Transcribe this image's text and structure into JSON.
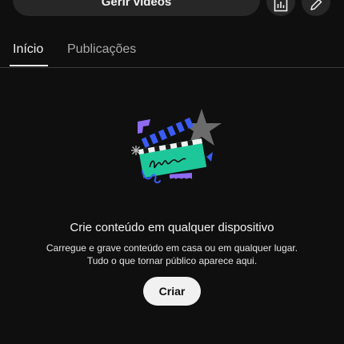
{
  "toolbar": {
    "manage_videos_label": "Gerir vídeos",
    "analytics_icon": "bar-chart-icon",
    "edit_icon": "pencil-icon"
  },
  "tabs": [
    {
      "label": "Início",
      "active": true
    },
    {
      "label": "Publicações",
      "active": false
    }
  ],
  "empty_state": {
    "illustration_icon": "clapperboard-illustration",
    "title": "Crie conteúdo em qualquer dispositivo",
    "body_line1": "Carregue e grave conteúdo em casa ou em qualquer lugar.",
    "body_line2": "Tudo o que tornar público aparece aqui.",
    "button_label": "Criar"
  },
  "colors": {
    "background": "#0f0f0f",
    "surface": "#272727",
    "text_primary": "#f1f1f1",
    "text_secondary": "#aaaaaa",
    "button_light": "#f1f1f1",
    "accent_teal": "#1ec79a",
    "accent_blue": "#3a5cf5",
    "accent_purple": "#8f6bf2",
    "star_gray": "#6b6b6b"
  }
}
